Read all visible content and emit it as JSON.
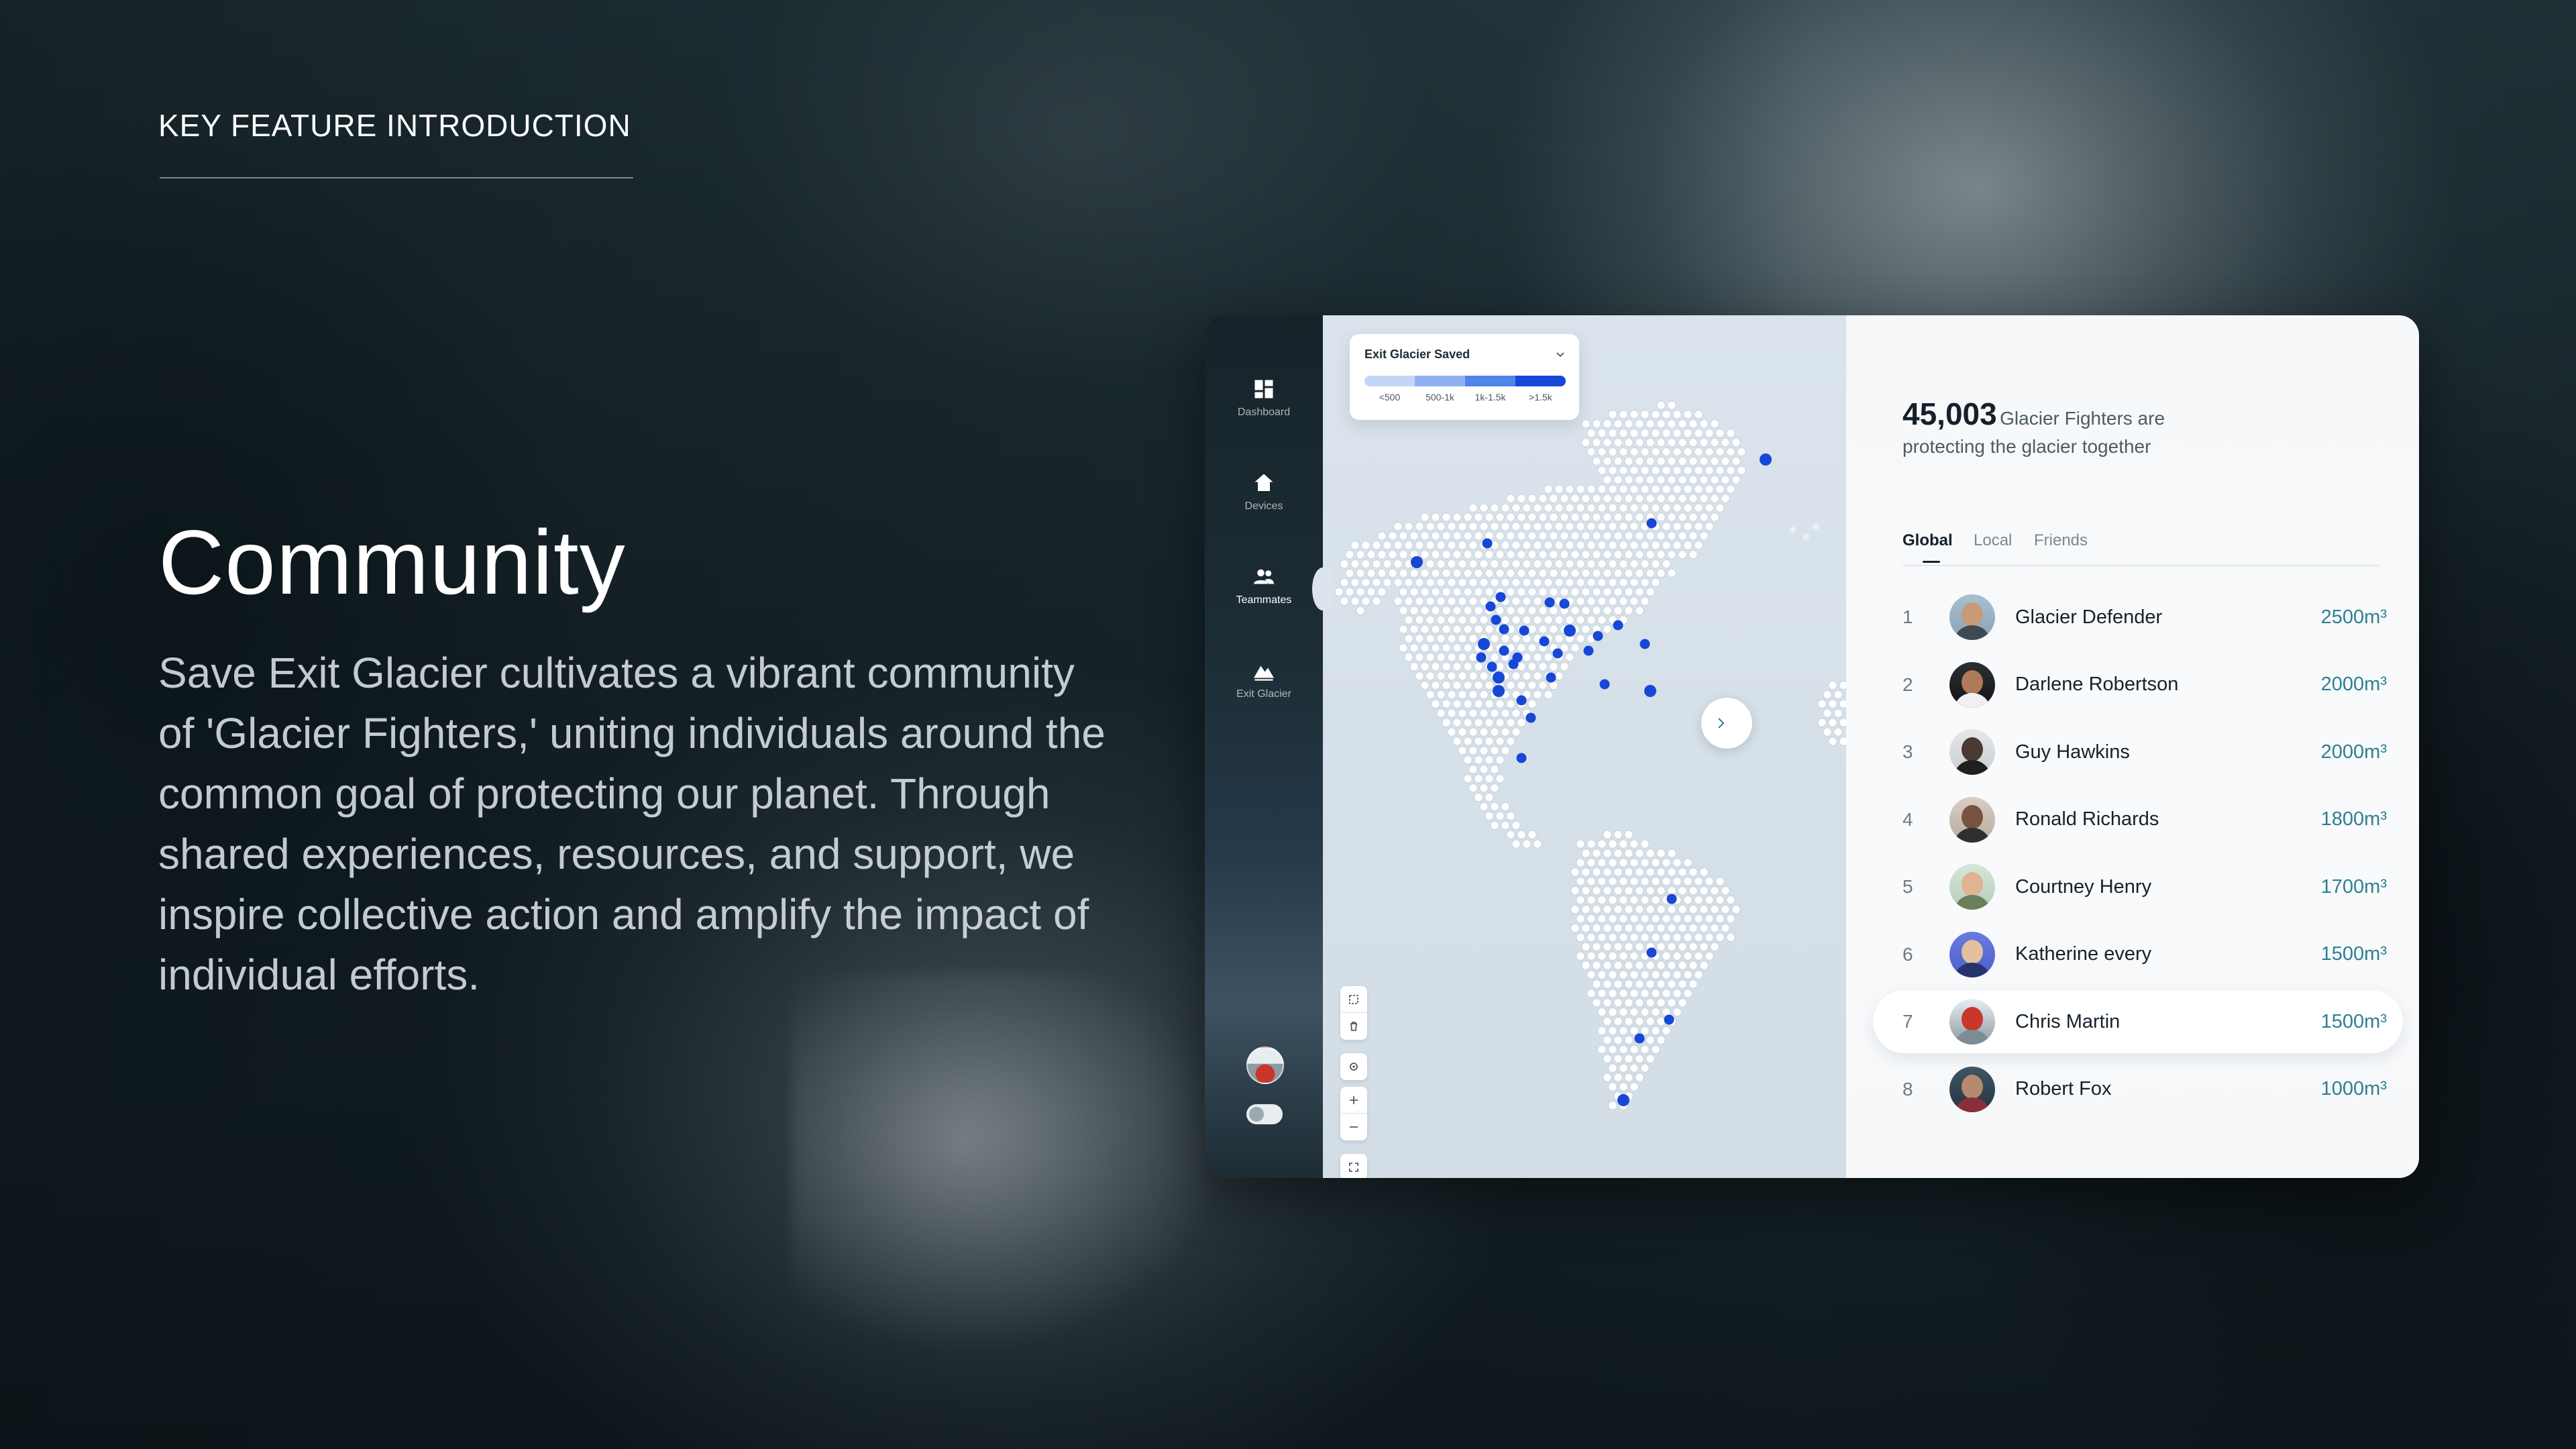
{
  "eyebrow": "KEY FEATURE INTRODUCTION",
  "headline": "Community",
  "body": "Save Exit Glacier cultivates a vibrant community of 'Glacier Fighters,' uniting individuals around the common goal of protecting our planet. Through shared experiences, resources, and support, we inspire collective action and amplify the impact of individual efforts.",
  "app": {
    "sidebar": {
      "items": [
        {
          "label": "Dashboard",
          "icon": "dashboard-icon"
        },
        {
          "label": "Devices",
          "icon": "home-icon"
        },
        {
          "label": "Teammates",
          "icon": "people-icon"
        },
        {
          "label": "Exit Glacier",
          "icon": "mountain-icon"
        }
      ]
    },
    "map": {
      "legend_title": "Exit Glacier Saved",
      "legend_labels": [
        "<500",
        "500-1k",
        "1k-1.5k",
        ">1.5k"
      ],
      "legend_colors": [
        "#c4d6f6",
        "#8fb1f0",
        "#4f84ea",
        "#1747d6"
      ],
      "accent": "#1747d6"
    },
    "panel": {
      "stat_number": "45,003",
      "stat_suffix": "Glacier Fighters are",
      "stat_line2": "protecting the glacier together",
      "tabs": [
        "Global",
        "Local",
        "Friends"
      ],
      "active_tab": "Global",
      "value_color": "#2e7f93",
      "leaderboard": [
        {
          "rank": "1",
          "name": "Glacier Defender",
          "value": "2500m³"
        },
        {
          "rank": "2",
          "name": "Darlene Robertson",
          "value": "2000m³"
        },
        {
          "rank": "3",
          "name": "Guy Hawkins",
          "value": "2000m³"
        },
        {
          "rank": "4",
          "name": "Ronald Richards",
          "value": "1800m³"
        },
        {
          "rank": "5",
          "name": "Courtney Henry",
          "value": "1700m³"
        },
        {
          "rank": "6",
          "name": "Katherine every",
          "value": "1500m³"
        },
        {
          "rank": "7",
          "name": "Chris Martin",
          "value": "1500m³"
        },
        {
          "rank": "8",
          "name": "Robert Fox",
          "value": "1000m³"
        }
      ],
      "highlighted_rank": "7"
    }
  }
}
